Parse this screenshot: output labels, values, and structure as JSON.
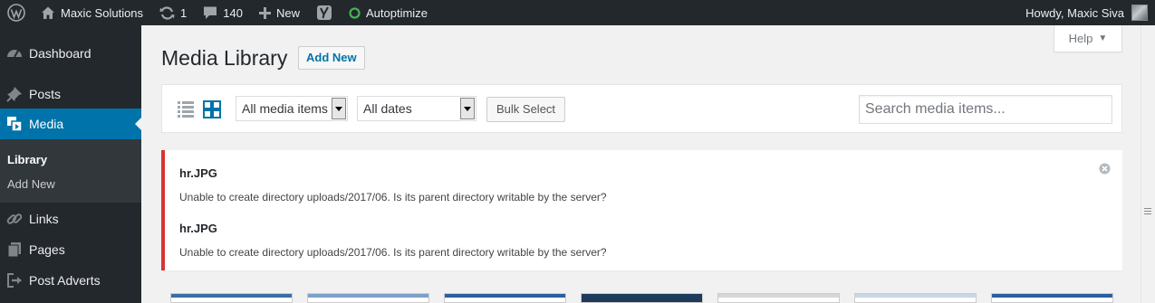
{
  "admin_bar": {
    "site_name": "Maxic Solutions",
    "updates_count": "1",
    "comments_count": "140",
    "new_label": "New",
    "autoptimize_label": "Autoptimize",
    "greeting": "Howdy, Maxic Siva"
  },
  "sidebar": {
    "items": [
      {
        "label": "Dashboard",
        "icon": "dashboard-icon"
      },
      {
        "label": "Posts",
        "icon": "pin-icon"
      },
      {
        "label": "Media",
        "icon": "media-icon"
      },
      {
        "label": "Links",
        "icon": "link-icon"
      },
      {
        "label": "Pages",
        "icon": "pages-icon"
      },
      {
        "label": "Post Adverts",
        "icon": "exit-icon"
      }
    ],
    "submenu": [
      {
        "label": "Library"
      },
      {
        "label": "Add New"
      }
    ]
  },
  "page": {
    "title": "Media Library",
    "add_new_label": "Add New",
    "help_label": "Help"
  },
  "toolbar": {
    "type_filter": "All media items",
    "date_filter": "All dates",
    "bulk_select_label": "Bulk Select",
    "search_placeholder": "Search media items..."
  },
  "errors": [
    {
      "file": "hr.JPG",
      "message": "Unable to create directory uploads/2017/06. Is its parent directory writable by the server?"
    },
    {
      "file": "hr.JPG",
      "message": "Unable to create directory uploads/2017/06. Is its parent directory writable by the server?"
    }
  ],
  "colors": {
    "admin_bar_bg": "#23282d",
    "accent": "#0073aa",
    "error": "#dc3232",
    "autoptimize_status": "#46b450"
  }
}
